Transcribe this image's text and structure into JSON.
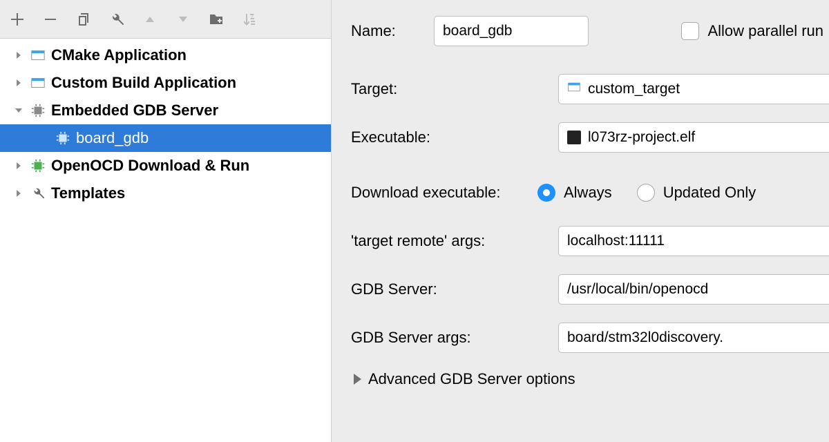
{
  "tree": {
    "items": [
      {
        "label": "CMake Application",
        "expanded": false,
        "iconType": "app"
      },
      {
        "label": "Custom Build Application",
        "expanded": false,
        "iconType": "app"
      },
      {
        "label": "Embedded GDB Server",
        "expanded": true,
        "iconType": "chip",
        "children": [
          {
            "label": "board_gdb",
            "selected": true,
            "iconType": "chip"
          }
        ]
      },
      {
        "label": "OpenOCD Download & Run",
        "expanded": false,
        "iconType": "chip-green"
      },
      {
        "label": "Templates",
        "expanded": false,
        "iconType": "wrench"
      }
    ]
  },
  "form": {
    "name_label": "Name:",
    "name_value": "board_gdb",
    "allow_parallel_label": "Allow parallel run",
    "allow_parallel_checked": false,
    "target_label": "Target:",
    "target_value": "custom_target",
    "executable_label": "Executable:",
    "executable_value": "l073rz-project.elf",
    "download_label": "Download executable:",
    "download_options": [
      "Always",
      "Updated Only"
    ],
    "download_selected": "Always",
    "remote_args_label": "'target remote' args:",
    "remote_args_value": "localhost:11111",
    "gdb_server_label": "GDB Server:",
    "gdb_server_value": "/usr/local/bin/openocd",
    "gdb_server_args_label": "GDB Server args:",
    "gdb_server_args_value": "board/stm32l0discovery.",
    "advanced_label": "Advanced GDB Server options"
  }
}
